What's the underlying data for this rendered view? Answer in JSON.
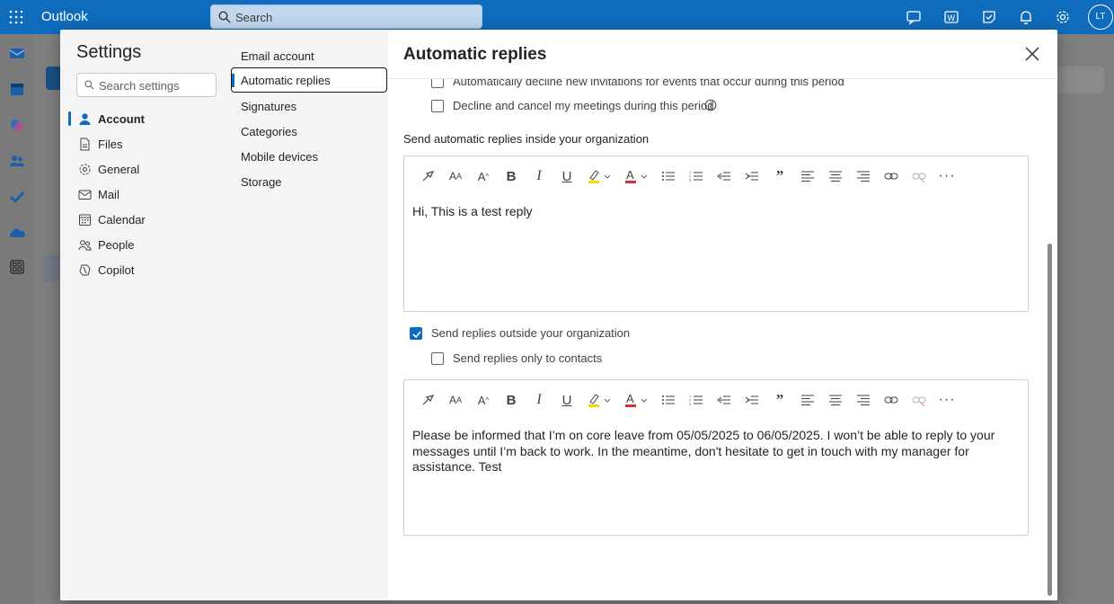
{
  "app": {
    "name": "Outlook",
    "search_placeholder": "Search",
    "avatar_initials": "LT"
  },
  "settings": {
    "title": "Settings",
    "search_placeholder": "Search settings",
    "categories": [
      {
        "label": "Account",
        "icon": "person-icon"
      },
      {
        "label": "Files",
        "icon": "file-icon"
      },
      {
        "label": "General",
        "icon": "gear-icon"
      },
      {
        "label": "Mail",
        "icon": "mail-icon"
      },
      {
        "label": "Calendar",
        "icon": "calendar-icon"
      },
      {
        "label": "People",
        "icon": "people-icon"
      },
      {
        "label": "Copilot",
        "icon": "copilot-icon"
      }
    ],
    "subcategories": [
      {
        "label": "Email account"
      },
      {
        "label": "Automatic replies"
      },
      {
        "label": "Signatures"
      },
      {
        "label": "Categories"
      },
      {
        "label": "Mobile devices"
      },
      {
        "label": "Storage"
      }
    ]
  },
  "pane": {
    "title": "Automatic replies",
    "decline_invitations_label": "Automatically decline new invitations for events that occur during this period",
    "decline_cancel_label": "Decline and cancel my meetings during this period",
    "inside_org_label": "Send automatic replies inside your organization",
    "inside_message": "Hi, This is a test reply",
    "outside_org_label": "Send replies outside your organization",
    "outside_org_checked": true,
    "contacts_only_label": "Send replies only to contacts",
    "contacts_only_checked": false,
    "outside_message": "Please be informed that I’m on core leave from 05/05/2025 to 06/05/2025. I won’t be able to reply to your messages until I’m back to work. In the meantime, don't hesitate to get in touch with my manager for assistance. Test"
  },
  "colors": {
    "brand": "#0f6cbd",
    "highlight": "#ffd700",
    "font_color": "#d13438"
  }
}
